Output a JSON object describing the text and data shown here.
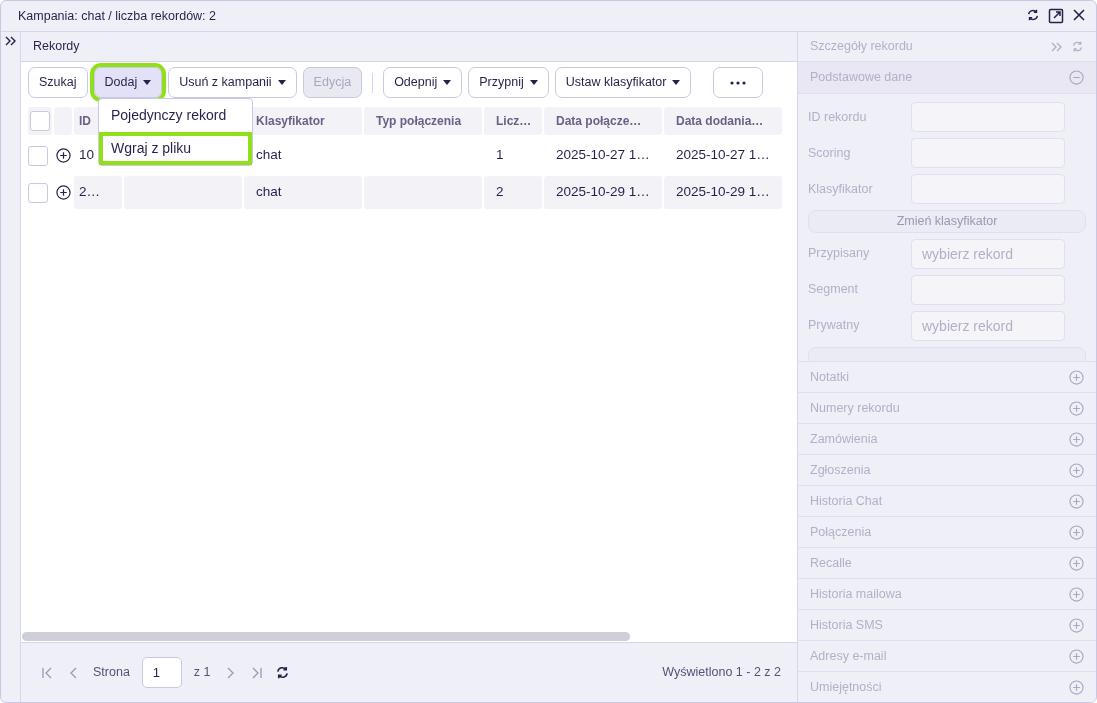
{
  "window": {
    "title": "Kampania: chat / liczba rekordów: 2"
  },
  "panel": {
    "title": "Rekordy"
  },
  "toolbar": [
    {
      "label": "Szukaj",
      "dropdown": false,
      "disabled": false,
      "highlighted": false
    },
    {
      "label": "Dodaj",
      "dropdown": true,
      "disabled": false,
      "highlighted": true
    },
    {
      "label": "Usuń z kampanii",
      "dropdown": true,
      "disabled": false,
      "highlighted": false
    },
    {
      "label": "Edycja",
      "dropdown": false,
      "disabled": true,
      "highlighted": false
    },
    {
      "label": "Odepnij",
      "dropdown": true,
      "disabled": false,
      "highlighted": false
    },
    {
      "label": "Przypnij",
      "dropdown": true,
      "disabled": false,
      "highlighted": false
    },
    {
      "label": "Ustaw klasyfikator",
      "dropdown": true,
      "disabled": false,
      "highlighted": false
    }
  ],
  "menu": [
    {
      "label": "Pojedynczy rekord",
      "highlighted": false
    },
    {
      "label": "Wgraj z pliku",
      "highlighted": true
    }
  ],
  "table": {
    "all_checked": false,
    "columns": [
      "ID",
      "",
      "Klasyfikator",
      "Typ połączenia",
      "Licz…",
      "Data połącze…",
      "Data dodania…"
    ],
    "rows": [
      {
        "checked": false,
        "cells": [
          "10",
          "",
          "chat",
          "",
          "1",
          "2025-10-27 1…",
          "2025-10-27 1…"
        ]
      },
      {
        "checked": false,
        "cells": [
          "2…",
          "",
          "chat",
          "",
          "2",
          "2025-10-29 1…",
          "2025-10-29 1…"
        ]
      }
    ]
  },
  "pager": {
    "page_label": "Strona",
    "page": "1",
    "of": "z 1",
    "summary": "Wyświetlono 1 - 2 z 2"
  },
  "details": {
    "title": "Szczegóły rekordu",
    "section": "Podstawowe dane",
    "fields": [
      {
        "kind": "field",
        "label": "ID rekordu"
      },
      {
        "kind": "field",
        "label": "Scoring"
      },
      {
        "kind": "field",
        "label": "Klasyfikator"
      },
      {
        "kind": "button",
        "label": "Zmień klasyfikator"
      },
      {
        "kind": "field",
        "label": "Przypisany",
        "placeholder": "wybierz rekord"
      },
      {
        "kind": "field",
        "label": "Segment"
      },
      {
        "kind": "field",
        "label": "Prywatny",
        "placeholder": "wybierz rekord"
      }
    ],
    "sections": [
      "Notatki",
      "Numery rekordu",
      "Zamówienia",
      "Zgłoszenia",
      "Historia Chat",
      "Połączenia",
      "Recalle",
      "Historia mailowa",
      "Historia SMS",
      "Adresy e-mail",
      "Umiejętności"
    ]
  }
}
